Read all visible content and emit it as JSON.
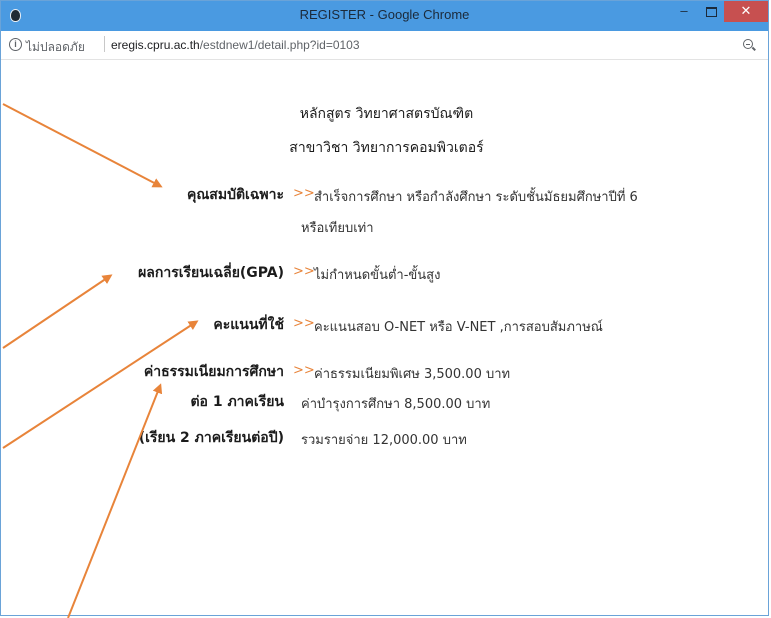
{
  "window": {
    "title": "REGISTER - Google Chrome",
    "minimize": "–",
    "close": "✕"
  },
  "address": {
    "security_label": "ไม่ปลอดภัย",
    "url_domain": "eregis.cpru.ac.th",
    "url_path": "/estdnew1/detail.php?id=0103"
  },
  "page": {
    "program": "หลักสูตร วิทยาศาสตรบัณฑิต",
    "major": "สาขาวิชา วิทยาการคอมพิวเตอร์",
    "arrow": ">>",
    "rows": [
      {
        "label": "คุณสมบัติเฉพาะ",
        "value": "สำเร็จการศึกษา หรือกำลังศึกษา ระดับชั้นมัธยมศึกษาปีที่ 6",
        "value2": "หรือเทียบเท่า"
      },
      {
        "label": "ผลการเรียนเฉลี่ย(GPA)",
        "value": "ไม่กำหนดขั้นต่ำ-ขั้นสูง"
      },
      {
        "label": "คะแนนที่ใช้",
        "value": "คะแนนสอบ O-NET หรือ V-NET ,การสอบสัมภาษณ์"
      },
      {
        "label": "ค่าธรรมเนียมการศึกษา",
        "value": "ค่าธรรมเนียมพิเศษ 3,500.00 บาท"
      },
      {
        "label": "ต่อ 1 ภาคเรียน",
        "value": "ค่าบำรุงการศึกษา 8,500.00 บาท"
      },
      {
        "label": "(เรียน 2 ภาคเรียนต่อปี)",
        "value": "รวมรายจ่าย 12,000.00 บาท"
      }
    ]
  },
  "colors": {
    "titlebar": "#4a9ae1",
    "close_button": "#c75050",
    "annotation_arrow": "#e8843a"
  }
}
